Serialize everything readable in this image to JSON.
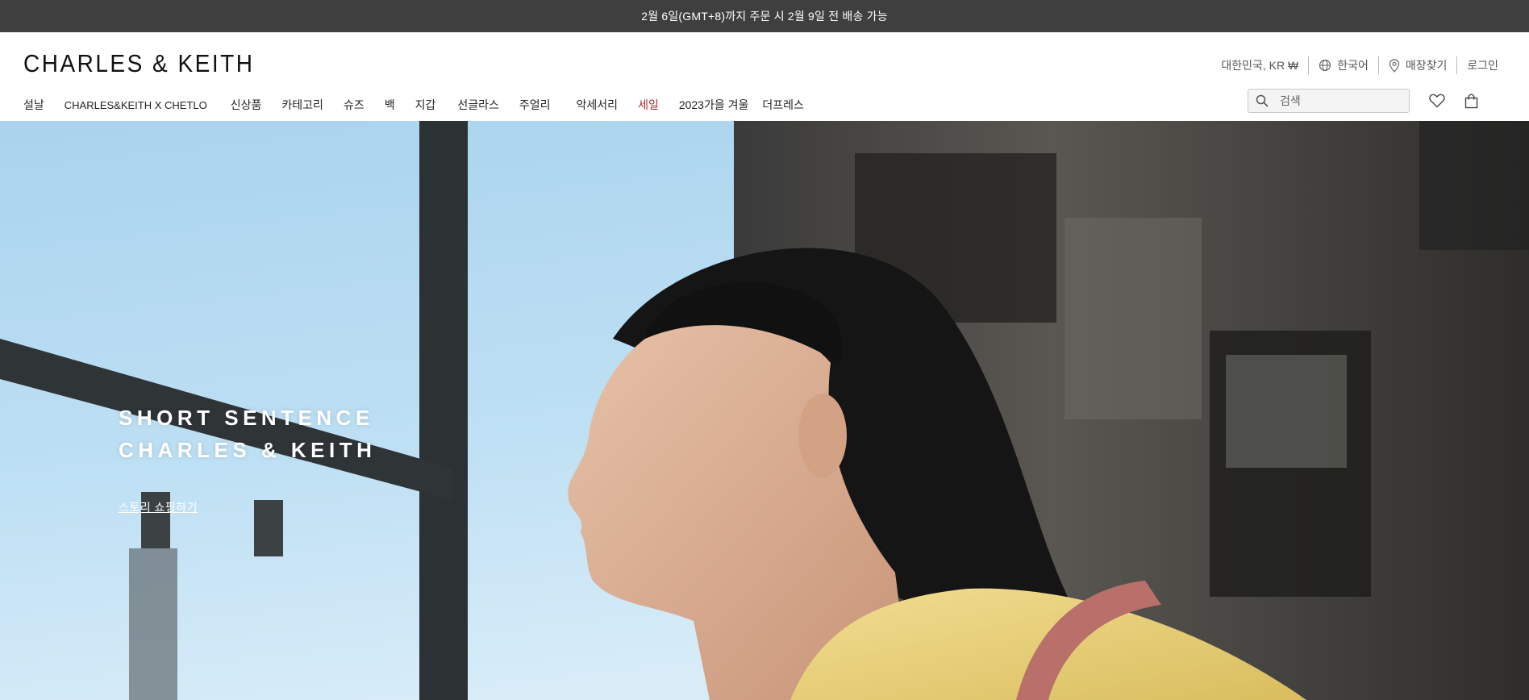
{
  "promo": {
    "text": "2월 6일(GMT+8)까지 주문 시 2월 9일 전 배송 가능"
  },
  "brand": {
    "logo_text": "CHARLES & KEITH"
  },
  "utility_nav": {
    "region": "대한민국, KR ₩",
    "language": "한국어",
    "store_locator": "매장찾기",
    "login": "로그인"
  },
  "main_nav": {
    "items": [
      {
        "label": "설날"
      },
      {
        "label": "CHARLES&KEITH X CHETLO"
      },
      {
        "label": "신상품"
      },
      {
        "label": "카테고리"
      },
      {
        "label": "슈즈"
      },
      {
        "label": "백"
      },
      {
        "label": "지갑"
      },
      {
        "label": "선글라스"
      },
      {
        "label": "주얼리"
      },
      {
        "label": "악세서리"
      },
      {
        "label": "세일"
      },
      {
        "label": "2023가을 겨울"
      },
      {
        "label": "더프레스"
      }
    ]
  },
  "search": {
    "placeholder": "검색"
  },
  "icons": {
    "wishlist": "heart-icon",
    "bag": "shopping-bag-icon",
    "search": "search-icon",
    "language": "globe-icon",
    "store": "location-pin-icon"
  },
  "hero": {
    "title_line1": "SHORT SENTENCE",
    "title_line2": "CHARLES & KEITH",
    "cta": "스토리 쇼핑하기"
  },
  "colors": {
    "promo_bg": "#3f3f3f",
    "sale": "#b3262e"
  }
}
